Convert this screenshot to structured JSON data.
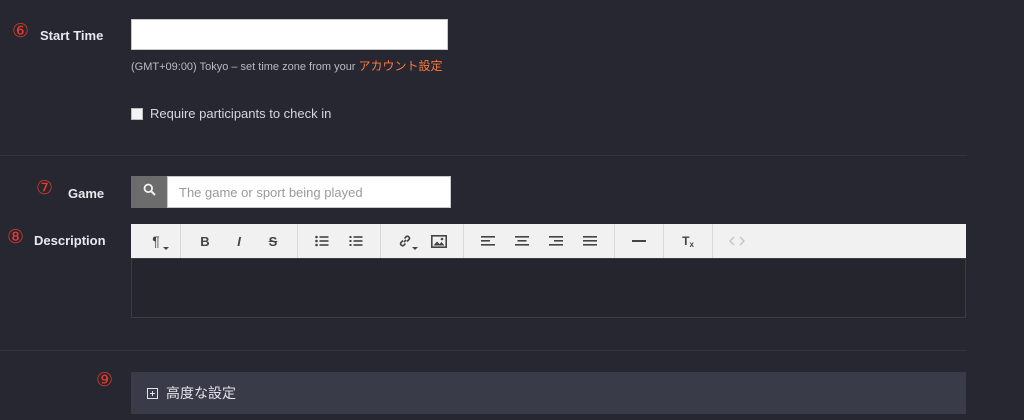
{
  "start_time": {
    "step": "⑥",
    "label": "Start Time",
    "value": "",
    "help_prefix": "(GMT+09:00) Tokyo – set time zone from your",
    "help_link": "アカウント設定"
  },
  "check_in": {
    "checked": false,
    "label": "Require participants to check in"
  },
  "game": {
    "step": "⑦",
    "label": "Game",
    "placeholder": "The game or sport being played"
  },
  "description": {
    "step": "⑧",
    "label": "Description",
    "toolbar": [
      "paragraph-format",
      "bold",
      "italic",
      "strikethrough",
      "bulleted-list",
      "numbered-list",
      "link",
      "image",
      "align-left",
      "align-center",
      "align-right",
      "align-justify",
      "horizontal-rule",
      "clear-formatting",
      "code-view"
    ],
    "toolbar_text": {
      "bold": "B",
      "italic": "I",
      "strike": "S",
      "paragraph": "¶",
      "clear": "T"
    }
  },
  "advanced": {
    "step": "⑨",
    "label": "高度な設定"
  },
  "colors": {
    "background": "#262730",
    "step_marker": "#e33a2c",
    "link": "#ff7a3d",
    "advanced_bar": "#3a3b48",
    "toolbar": "#f1f1f1"
  }
}
